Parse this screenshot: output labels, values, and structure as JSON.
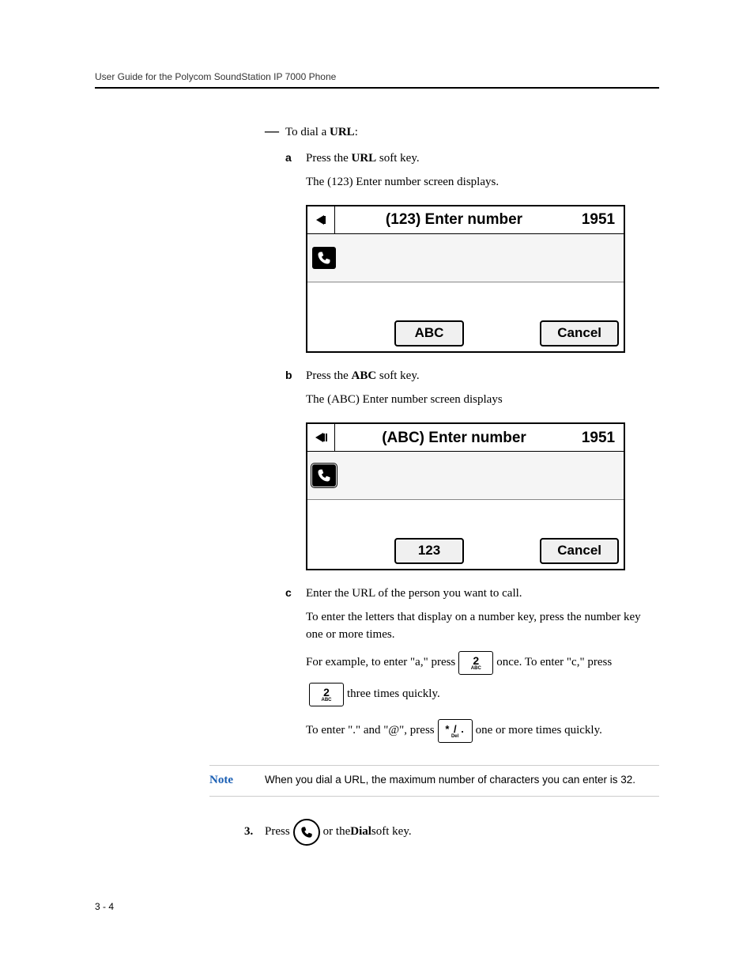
{
  "header": "User Guide for the Polycom SoundStation IP 7000 Phone",
  "intro": {
    "dash_line_prefix": "To dial a ",
    "dash_line_bold": "URL",
    "dash_line_suffix": ":"
  },
  "step_a": {
    "letter": "a",
    "line1_prefix": "Press the ",
    "line1_bold": "URL",
    "line1_suffix": " soft key.",
    "line2": "The (123) Enter number screen displays."
  },
  "screen1": {
    "title": "(123) Enter number",
    "time": "1951",
    "softkey_left": "ABC",
    "softkey_right": "Cancel"
  },
  "step_b": {
    "letter": "b",
    "line1_prefix": "Press the ",
    "line1_bold": "ABC",
    "line1_suffix": " soft key.",
    "line2": "The (ABC) Enter number screen displays"
  },
  "screen2": {
    "title": "(ABC) Enter number",
    "time": "1951",
    "softkey_left": "123",
    "softkey_right": "Cancel"
  },
  "step_c": {
    "letter": "c",
    "line1": "Enter the URL of the person you want to call.",
    "line2": "To enter the letters that display on a number key, press the number key one or more times.",
    "ex_prefix": "For example, to enter \"a,\" press",
    "ex_mid": "once. To enter \"c,\" press",
    "ex_suffix": "three times quickly.",
    "sym_prefix": "To enter \".\" and \"@\", press",
    "sym_suffix": "one or more times quickly.",
    "key2_top": "2",
    "key2_bottom": "ABC",
    "keystar_top": "* / .",
    "keystar_bottom": "Del"
  },
  "note": {
    "label": "Note",
    "text": "When you dial a URL, the maximum number of characters you can enter is 32."
  },
  "step3": {
    "num": "3.",
    "prefix": "Press",
    "mid": "or the ",
    "bold": "Dial",
    "suffix": " soft key."
  },
  "footer": "3 - 4"
}
